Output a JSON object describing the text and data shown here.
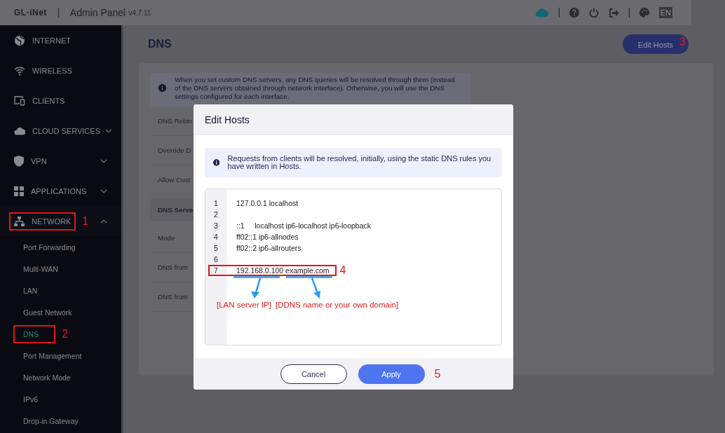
{
  "header": {
    "brand": "GL·iNet",
    "title": "Admin Panel",
    "version": "v4.7.11",
    "language": "EN"
  },
  "sidebar": {
    "items": [
      {
        "label": "INTERNET",
        "kind": "link"
      },
      {
        "label": "WIRELESS",
        "kind": "link"
      },
      {
        "label": "CLIENTS",
        "kind": "link"
      },
      {
        "label": "CLOUD SERVICES",
        "kind": "group",
        "expanded": false
      },
      {
        "label": "VPN",
        "kind": "group",
        "expanded": false
      },
      {
        "label": "APPLICATIONS",
        "kind": "group",
        "expanded": false
      },
      {
        "label": "NETWORK",
        "kind": "group",
        "expanded": true,
        "callout": "1",
        "children": [
          {
            "label": "Port Forwarding",
            "selected": false
          },
          {
            "label": "Multi-WAN",
            "selected": false
          },
          {
            "label": "LAN",
            "selected": false
          },
          {
            "label": "Guest Network",
            "selected": false
          },
          {
            "label": "DNS",
            "selected": true,
            "callout": "2"
          },
          {
            "label": "Port Management",
            "selected": false
          },
          {
            "label": "Network Mode",
            "selected": false
          },
          {
            "label": "IPv6",
            "selected": false
          },
          {
            "label": "Drop-in Gateway",
            "selected": false
          }
        ]
      }
    ]
  },
  "page": {
    "title": "DNS",
    "edit_button": {
      "label": "Edit Hosts",
      "callout": "3"
    },
    "notice": "When you set custom DNS servers, any DNS queries will be resolved through them (instead of the DNS servers obtained through network interface). Otherwise, you will use the DNS settings configured for each interface.",
    "rows": [
      {
        "label": "DNS Rebin",
        "kind": "row"
      },
      {
        "label": "Override D",
        "kind": "row"
      },
      {
        "label": "Allow Cust",
        "kind": "row"
      },
      {
        "label": "DNS Serve",
        "kind": "section"
      },
      {
        "label": "Mode",
        "kind": "row"
      },
      {
        "label": "DNS from",
        "kind": "row"
      },
      {
        "label": "DNS from",
        "kind": "row"
      }
    ]
  },
  "modal": {
    "title": "Edit Hosts",
    "notice": "Requests from clients will be resolved, initially, using the static DNS rules you have written in Hosts.",
    "lines": [
      {
        "number": "1",
        "text": "127.0.0.1 localhost"
      },
      {
        "number": "2"
      },
      {
        "number": "3",
        "text": "::1     localhost ip6-localhost ip6-loopback"
      },
      {
        "number": "4",
        "text": "ff02::1 ip6-allnodes"
      },
      {
        "number": "5",
        "text": "ff02::2 ip6-allrouters"
      },
      {
        "number": "6"
      },
      {
        "number": "7",
        "text": "192.168.0.100 example.com",
        "callout": "4"
      }
    ],
    "annotations": [
      "[LAN server IP]",
      "[DDNS name or your own domain]"
    ],
    "buttons": [
      {
        "label": "Cancel",
        "kind": "secondary"
      },
      {
        "label": "Apply",
        "kind": "primary",
        "callout": "5"
      }
    ]
  }
}
